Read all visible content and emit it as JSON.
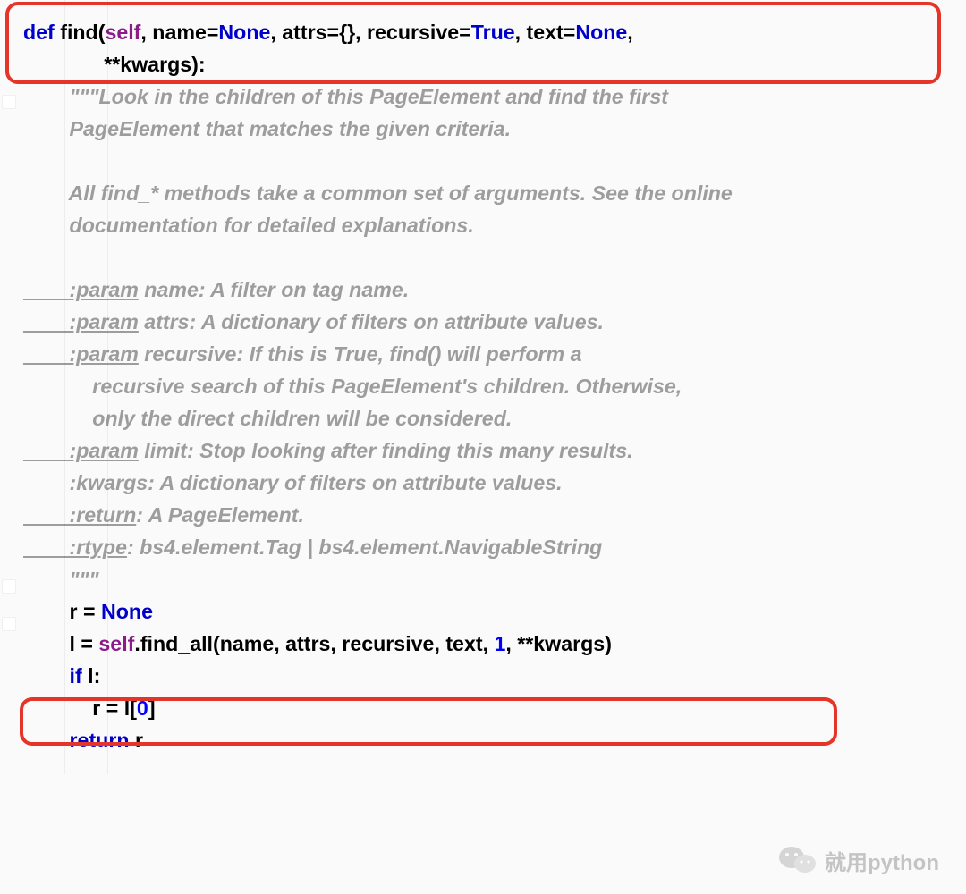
{
  "code": {
    "sig1_def": "def",
    "sig1_sp": " ",
    "sig1_name": "find(",
    "sig1_self": "self",
    "sig1_a": ", name=",
    "sig1_none1": "None",
    "sig1_b": ", attrs={}, recursive=",
    "sig1_true": "True",
    "sig1_c": ", text=",
    "sig1_none2": "None",
    "sig1_d": ",",
    "sig2": "              **kwargs):",
    "doc1a": "        \"\"\"Look in the children of this PageElement and find the first",
    "doc2": "        PageElement that matches the given criteria.",
    "blank": "",
    "doc3": "        All find_* methods take a common set of arguments. See the online",
    "doc4": "        documentation for detailed explanations.",
    "p1_u": "        :param",
    "p1_r": " name: A filter on tag name.",
    "p2_u": "        :param",
    "p2_r": " attrs: A dictionary of filters on attribute values.",
    "p3_u": "        :param",
    "p3_r": " recursive: If this is True, find() will perform a",
    "p3b": "            recursive search of this PageElement's children. Otherwise,",
    "p3c": "            only the direct children will be considered.",
    "p4_u": "        :param",
    "p4_r": " limit: Stop looking after finding this many results.",
    "p5": "        :kwargs: A dictionary of filters on attribute values.",
    "p6_u": "        :return",
    "p6_r": ": A PageElement.",
    "p7_u": "        :rtype",
    "p7_r": ": bs4.element.Tag | bs4.element.NavigableString",
    "doc_end": "        \"\"\"",
    "r1a": "        r = ",
    "r1b": "None",
    "l1a": "        l = ",
    "l1_self": "self",
    "l1b": ".find_all(name, attrs, recursive, text, ",
    "l1_num": "1",
    "l1c": ", **kwargs)",
    "if_kw": "        if",
    "if_r": " l:",
    "rass_a": "            r = l[",
    "rass_n": "0",
    "rass_b": "]",
    "ret_kw": "        return",
    "ret_r": " r"
  },
  "watermark": {
    "text": "就用python"
  }
}
